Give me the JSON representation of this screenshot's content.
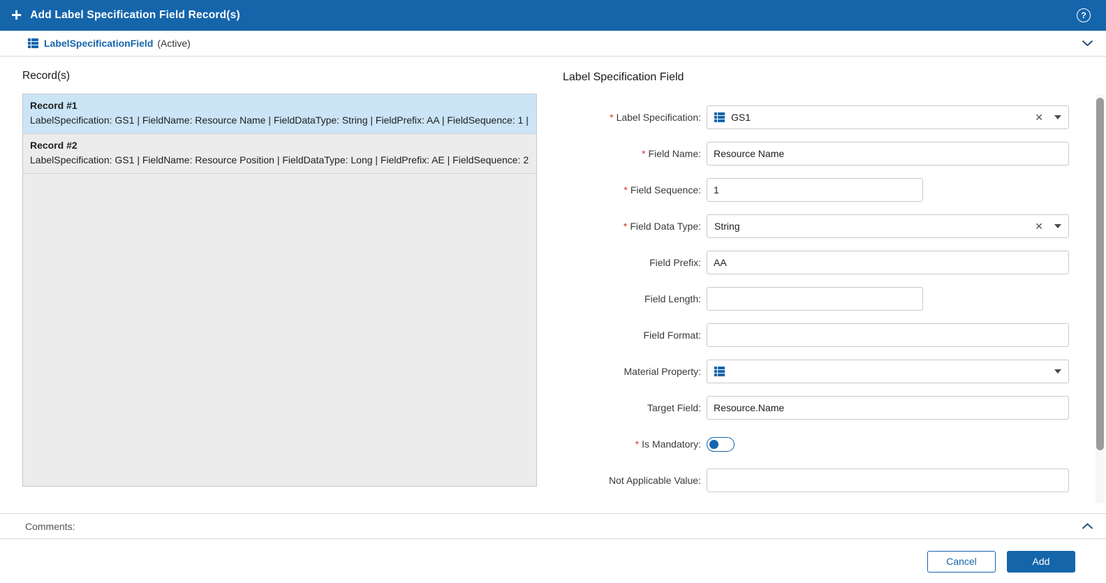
{
  "header": {
    "title": "Add Label Specification Field Record(s)"
  },
  "icons": {
    "plus": "+",
    "help": "?",
    "clear": "✕",
    "required_marker": "*"
  },
  "breadcrumb": {
    "entity": "LabelSpecificationField",
    "status": "(Active)"
  },
  "records_panel": {
    "title": "Record(s)",
    "records": [
      {
        "name": "Record #1",
        "summary": "LabelSpecification: GS1 | FieldName: Resource Name | FieldDataType: String | FieldPrefix: AA | FieldSequence: 1 |",
        "selected": true
      },
      {
        "name": "Record #2",
        "summary": "LabelSpecification: GS1 | FieldName: Resource Position | FieldDataType: Long | FieldPrefix: AE | FieldSequence: 2",
        "selected": false
      }
    ]
  },
  "form": {
    "title": "Label Specification Field",
    "fields": [
      {
        "label": "Label Specification:",
        "required": true,
        "type": "lookup",
        "value": "GS1"
      },
      {
        "label": "Field Name:",
        "required": true,
        "type": "text",
        "value": "Resource Name"
      },
      {
        "label": "Field Sequence:",
        "required": true,
        "type": "text",
        "value": "1"
      },
      {
        "label": "Field Data Type:",
        "required": true,
        "type": "select",
        "value": "String"
      },
      {
        "label": "Field Prefix:",
        "required": false,
        "type": "text",
        "value": "AA"
      },
      {
        "label": "Field Length:",
        "required": false,
        "type": "text",
        "value": ""
      },
      {
        "label": "Field Format:",
        "required": false,
        "type": "text",
        "value": ""
      },
      {
        "label": "Material Property:",
        "required": false,
        "type": "lookup",
        "value": ""
      },
      {
        "label": "Target Field:",
        "required": false,
        "type": "text",
        "value": "Resource.Name"
      },
      {
        "label": "Is Mandatory:",
        "required": true,
        "type": "toggle",
        "value": "off"
      },
      {
        "label": "Not Applicable Value:",
        "required": false,
        "type": "text",
        "value": ""
      }
    ]
  },
  "comments": {
    "label": "Comments:"
  },
  "footer": {
    "cancel_label": "Cancel",
    "add_label": "Add"
  },
  "colors": {
    "accent": "#1565ab",
    "selected_record": "#cbe4f6",
    "required": "#d0342c"
  }
}
